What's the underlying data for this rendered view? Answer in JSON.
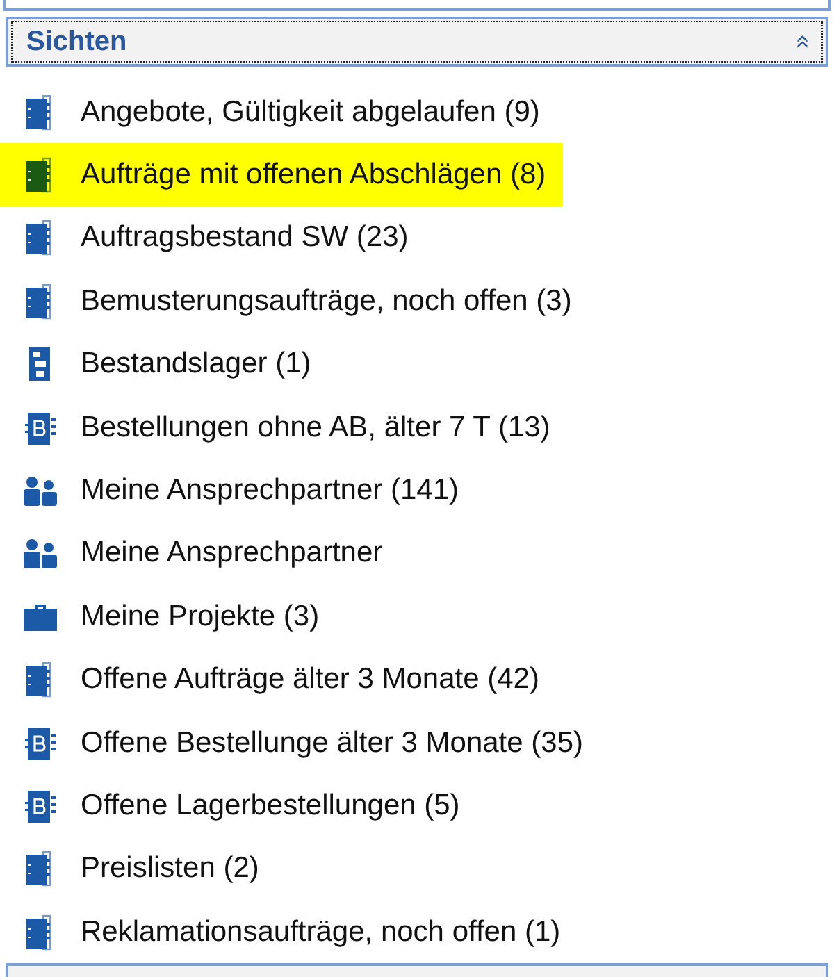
{
  "panel": {
    "title": "Sichten",
    "collapse_icon": "»",
    "expanded": true
  },
  "items": [
    {
      "label": "Angebote, Gültigkeit abgelaufen (9)",
      "kind": "notebook",
      "highlighted": false
    },
    {
      "label": "Aufträge mit offenen Abschlägen (8)",
      "kind": "notebook",
      "highlighted": true
    },
    {
      "label": "Auftragsbestand SW (23)",
      "kind": "notebook",
      "highlighted": false
    },
    {
      "label": "Bemusterungsaufträge, noch offen (3)",
      "kind": "notebook",
      "highlighted": false
    },
    {
      "label": "Bestandslager (1)",
      "kind": "storage",
      "highlighted": false
    },
    {
      "label": "Bestellungen ohne AB, älter 7 T (13)",
      "kind": "order-book",
      "highlighted": false
    },
    {
      "label": "Meine Ansprechpartner (141)",
      "kind": "people",
      "highlighted": false
    },
    {
      "label": "Meine Ansprechpartner",
      "kind": "people",
      "highlighted": false
    },
    {
      "label": "Meine Projekte (3)",
      "kind": "briefcase",
      "highlighted": false
    },
    {
      "label": "Offene Aufträge älter 3 Monate (42)",
      "kind": "notebook",
      "highlighted": false
    },
    {
      "label": "Offene Bestellunge älter 3 Monate (35)",
      "kind": "order-book",
      "highlighted": false
    },
    {
      "label": "Offene Lagerbestellungen (5)",
      "kind": "order-book",
      "highlighted": false
    },
    {
      "label": "Preislisten (2)",
      "kind": "notebook",
      "highlighted": false
    },
    {
      "label": "Reklamationsaufträge, noch offen (1)",
      "kind": "notebook",
      "highlighted": false
    }
  ]
}
